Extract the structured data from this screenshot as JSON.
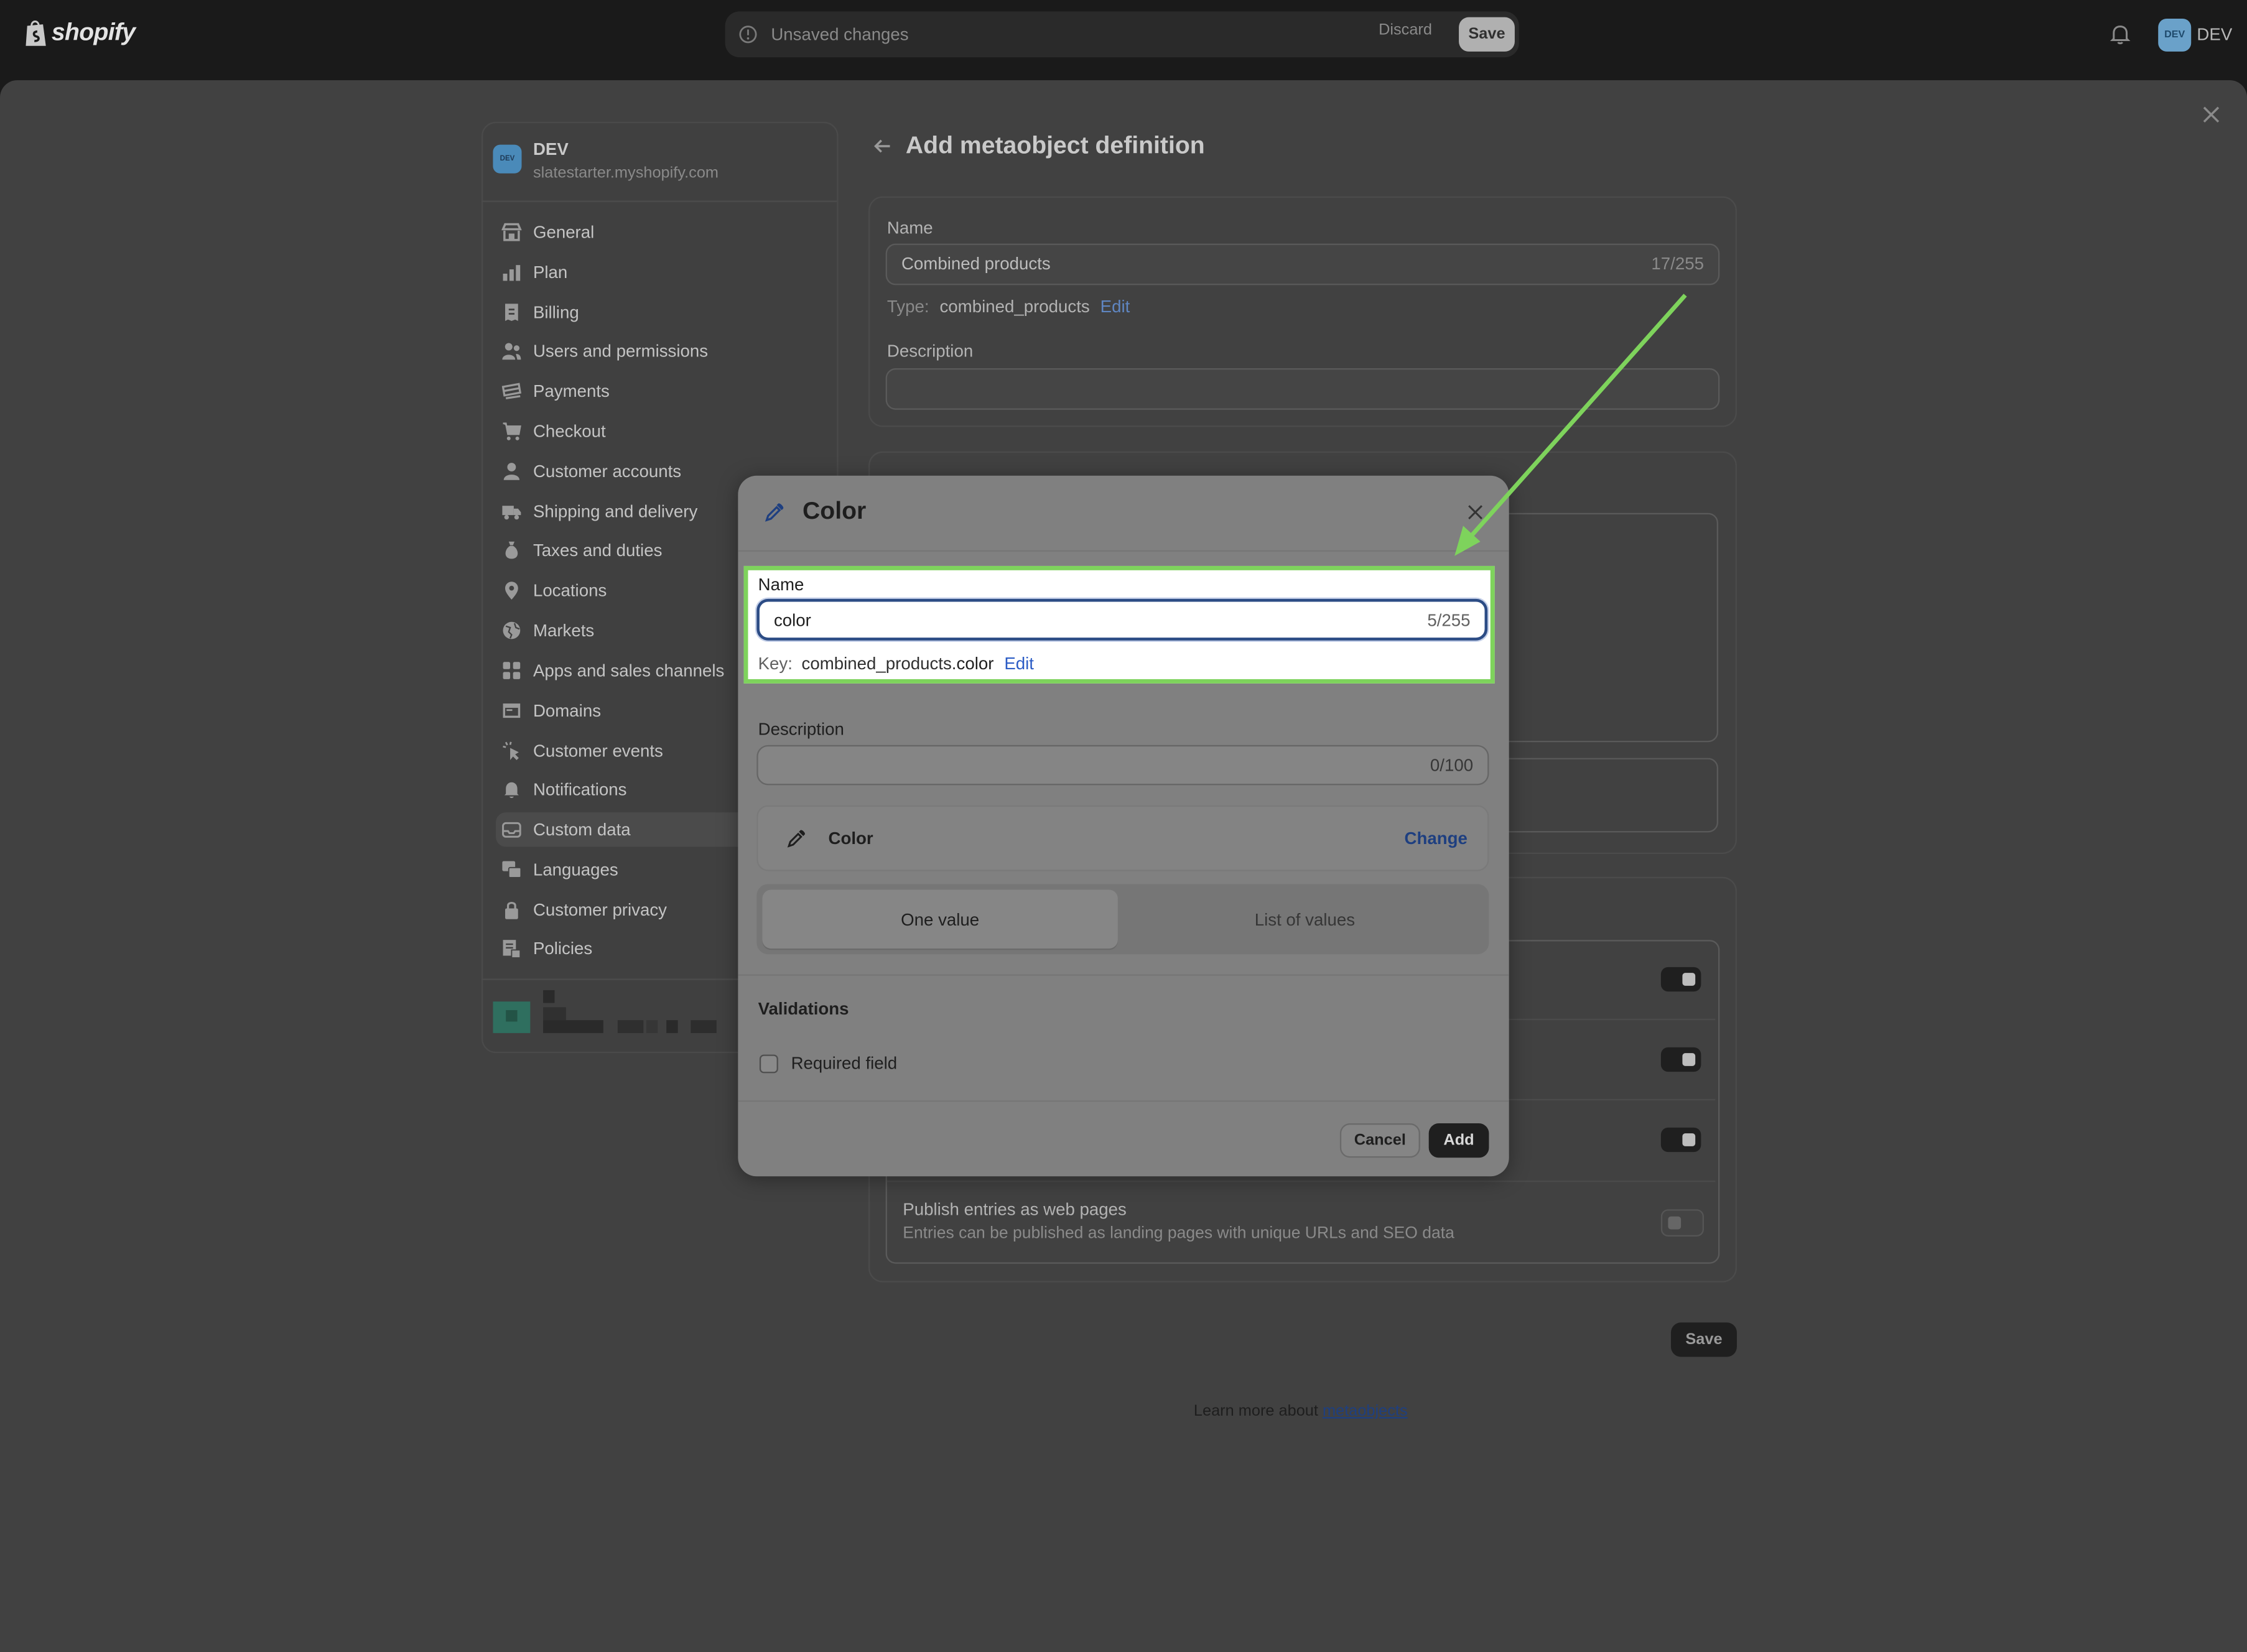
{
  "topbar": {
    "logo_text": "shopify",
    "unsaved_text": "Unsaved changes",
    "discard_label": "Discard",
    "save_label": "Save",
    "store_initials": "DEV",
    "store_name": "DEV"
  },
  "sidebar": {
    "store_initials": "DEV",
    "store_name": "DEV",
    "store_domain": "slatestarter.myshopify.com",
    "items": [
      {
        "label": "General"
      },
      {
        "label": "Plan"
      },
      {
        "label": "Billing"
      },
      {
        "label": "Users and permissions"
      },
      {
        "label": "Payments"
      },
      {
        "label": "Checkout"
      },
      {
        "label": "Customer accounts"
      },
      {
        "label": "Shipping and delivery"
      },
      {
        "label": "Taxes and duties"
      },
      {
        "label": "Locations"
      },
      {
        "label": "Markets"
      },
      {
        "label": "Apps and sales channels"
      },
      {
        "label": "Domains"
      },
      {
        "label": "Customer events"
      },
      {
        "label": "Notifications"
      },
      {
        "label": "Custom data",
        "active": true
      },
      {
        "label": "Languages"
      },
      {
        "label": "Customer privacy"
      },
      {
        "label": "Policies"
      }
    ]
  },
  "page": {
    "title": "Add metaobject definition",
    "name_label": "Name",
    "name_value": "Combined products",
    "name_count": "17/255",
    "type_prefix": "Type:",
    "type_value": "combined_products",
    "type_edit": "Edit",
    "description_label": "Description",
    "publish_title": "Publish entries as web pages",
    "publish_desc": "Entries can be published as landing pages with unique URLs and SEO data",
    "save_label": "Save",
    "learn_more_prefix": "Learn more about",
    "learn_more_link": "metaobjects"
  },
  "modal": {
    "title": "Color",
    "name_label": "Name",
    "name_value": "color",
    "name_count": "5/255",
    "key_prefix": "Key:",
    "key_value": "combined_products.",
    "key_bold": "color",
    "key_edit": "Edit",
    "description_label": "Description",
    "description_count": "0/100",
    "type_label": "Color",
    "type_change": "Change",
    "seg_one": "One value",
    "seg_list": "List of values",
    "validations_title": "Validations",
    "required_label": "Required field",
    "required_checked": false,
    "cancel_label": "Cancel",
    "add_label": "Add"
  },
  "colors": {
    "highlight": "#7ed35c",
    "arrow": "#7ed35c",
    "focus_border": "#2c4c85",
    "link": "#2c5cc5"
  }
}
